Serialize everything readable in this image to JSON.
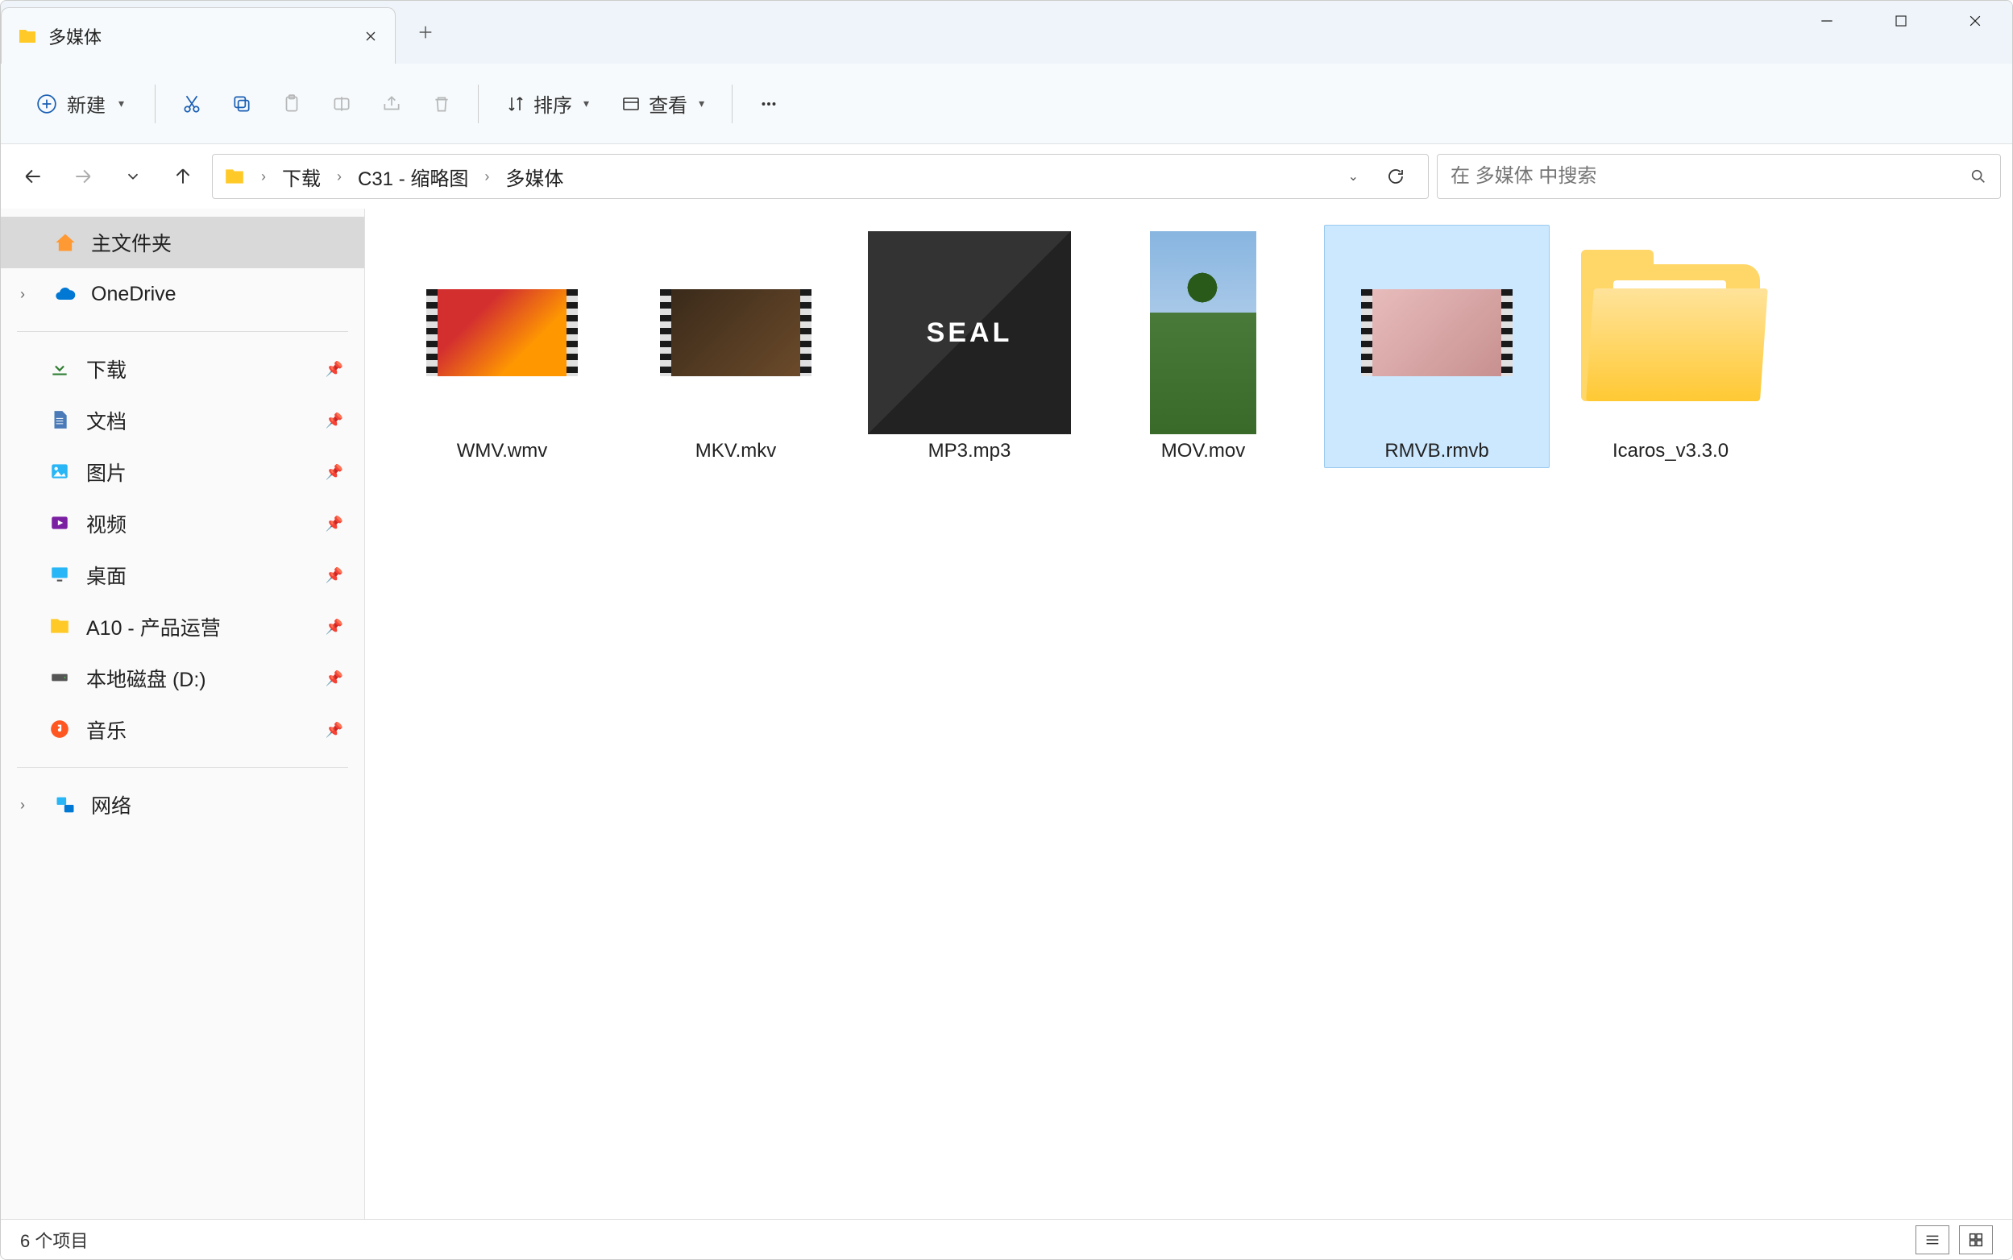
{
  "tab": {
    "title": "多媒体"
  },
  "toolbar": {
    "new_label": "新建",
    "sort_label": "排序",
    "view_label": "查看"
  },
  "breadcrumb": {
    "segments": [
      "下载",
      "C31 - 缩略图",
      "多媒体"
    ]
  },
  "search": {
    "placeholder": "在 多媒体 中搜索"
  },
  "sidebar": {
    "home": "主文件夹",
    "onedrive": "OneDrive",
    "items": [
      {
        "label": "下载"
      },
      {
        "label": "文档"
      },
      {
        "label": "图片"
      },
      {
        "label": "视频"
      },
      {
        "label": "桌面"
      },
      {
        "label": "A10 - 产品运营"
      },
      {
        "label": "本地磁盘 (D:)"
      },
      {
        "label": "音乐"
      }
    ],
    "network": "网络"
  },
  "files": [
    {
      "name": "WMV.wmv",
      "type": "video"
    },
    {
      "name": "MKV.mkv",
      "type": "video"
    },
    {
      "name": "MP3.mp3",
      "type": "audio",
      "cover_text": "SEAL"
    },
    {
      "name": "MOV.mov",
      "type": "image"
    },
    {
      "name": "RMVB.rmvb",
      "type": "video",
      "selected": true
    },
    {
      "name": "Icaros_v3.3.0",
      "type": "folder"
    }
  ],
  "status": {
    "text": "6 个项目"
  }
}
